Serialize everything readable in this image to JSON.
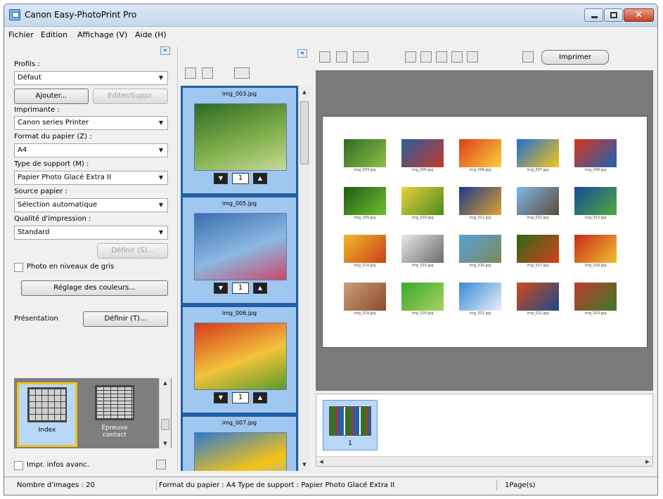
{
  "window": {
    "title": "Canon Easy-PhotoPrint Pro"
  },
  "menu": [
    "Fichier",
    "Edition",
    "Affichage (V)",
    "Aide (H)"
  ],
  "left": {
    "profils_label": "Profils :",
    "profils_value": "Défaut",
    "ajouter": "Ajouter...",
    "editer": "Editer/Suppr.",
    "imprimante_label": "Imprimante :",
    "imprimante_value": "Canon           series Printer",
    "format_label": "Format du papier (Z) :",
    "format_value": "A4",
    "support_label": "Type de support (M) :",
    "support_value": "Papier Photo Glacé Extra II",
    "source_label": "Source papier :",
    "source_value": "Sélection automatique",
    "qualite_label": "Qualité d'impression :",
    "qualite_value": "Standard",
    "definir_s": "Définir (S)...",
    "gris_label": "Photo en niveaux de gris",
    "couleurs": "Réglage des couleurs...",
    "presentation_label": "Présentation",
    "definir_t": "Définir (T)...",
    "layouts": [
      {
        "label": "Index",
        "selected": true
      },
      {
        "label": "Epreuve contact",
        "selected": false
      }
    ],
    "infos_label": "Impr. infos avanc."
  },
  "thumbnails": [
    {
      "name": "img_003.jpg",
      "copies": "1",
      "colors": [
        "#2f6a23",
        "#7fae4a",
        "#c9d99a"
      ]
    },
    {
      "name": "img_005.jpg",
      "copies": "1",
      "colors": [
        "#3a6fb0",
        "#8cb8e2",
        "#c94a6a"
      ]
    },
    {
      "name": "img_006.jpg",
      "copies": "1",
      "colors": [
        "#d63a1e",
        "#f2c33a",
        "#5a9a2a"
      ]
    },
    {
      "name": "img_007.jpg",
      "copies": "",
      "colors": [
        "#2e7bd0",
        "#f3c316",
        "#86b8e8"
      ]
    }
  ],
  "toolbar": {
    "imprimer": "Imprimer"
  },
  "preview": {
    "photos": [
      {
        "caption": "img_003.jpg",
        "colors": [
          "#2f6a23",
          "#8cc04a"
        ]
      },
      {
        "caption": "img_005.jpg",
        "colors": [
          "#2d5e9e",
          "#c0392b"
        ]
      },
      {
        "caption": "img_006.jpg",
        "colors": [
          "#e33c1c",
          "#f7d03c"
        ]
      },
      {
        "caption": "img_007.jpg",
        "colors": [
          "#1f6fd0",
          "#f5c518"
        ]
      },
      {
        "caption": "img_008.jpg",
        "colors": [
          "#d8341c",
          "#1e62b4"
        ]
      },
      {
        "caption": "img_009.jpg",
        "colors": [
          "#1e5c14",
          "#6fbf2f"
        ]
      },
      {
        "caption": "img_010.jpg",
        "colors": [
          "#e8d23c",
          "#4c8a1c"
        ]
      },
      {
        "caption": "img_011.jpg",
        "colors": [
          "#1a3a8a",
          "#e0a030"
        ]
      },
      {
        "caption": "img_012.jpg",
        "colors": [
          "#7fb8e8",
          "#5a4a3a"
        ]
      },
      {
        "caption": "img_013.jpg",
        "colors": [
          "#1a4a9a",
          "#4caa3a"
        ]
      },
      {
        "caption": "img_014.jpg",
        "colors": [
          "#f2b82a",
          "#c8401a"
        ]
      },
      {
        "caption": "img_015.jpg",
        "colors": [
          "#e8e8e8",
          "#6a6a6a"
        ]
      },
      {
        "caption": "img_016.jpg",
        "colors": [
          "#5aa0d8",
          "#7a8a5a"
        ]
      },
      {
        "caption": "img_017.jpg",
        "colors": [
          "#2a6a1a",
          "#d8401a"
        ]
      },
      {
        "caption": "img_018.jpg",
        "colors": [
          "#c82a1a",
          "#f0c030"
        ]
      },
      {
        "caption": "img_019.jpg",
        "colors": [
          "#c8a07a",
          "#8a4a2a"
        ]
      },
      {
        "caption": "img_020.jpg",
        "colors": [
          "#3aaa2a",
          "#a8d060"
        ]
      },
      {
        "caption": "img_021.jpg",
        "colors": [
          "#3a88d8",
          "#e8f0f8"
        ]
      },
      {
        "caption": "img_022.jpg",
        "colors": [
          "#d04a1a",
          "#1a4a8a"
        ]
      },
      {
        "caption": "img_023.jpg",
        "colors": [
          "#c03a2a",
          "#3a7a2a"
        ]
      }
    ]
  },
  "pages": [
    {
      "num": "1"
    }
  ],
  "status": {
    "count": "Nombre d'images : 20",
    "info": "Format du papier : A4  Type de support : Papier Photo Glacé Extra II",
    "pages": "1Page(s)"
  }
}
